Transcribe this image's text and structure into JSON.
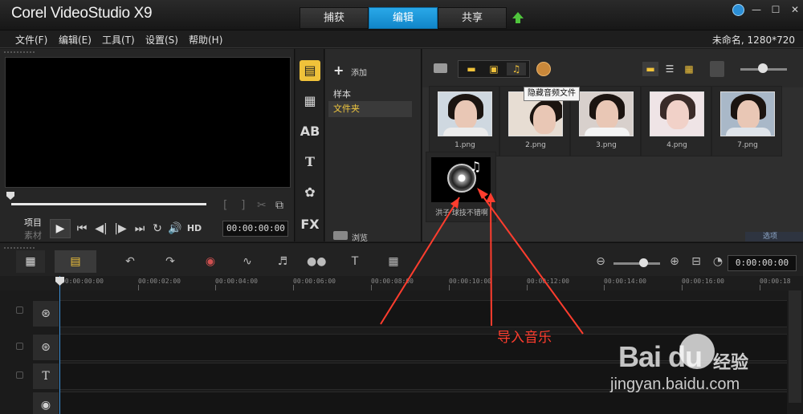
{
  "titlebar": {
    "app_title": "Corel VideoStudio X9",
    "tabs": [
      {
        "label": "捕获",
        "active": false
      },
      {
        "label": "编辑",
        "active": true
      },
      {
        "label": "共享",
        "active": false
      }
    ],
    "accent_color": "#1b9ad8"
  },
  "menu": {
    "items": [
      "文件(F)",
      "编辑(E)",
      "工具(T)",
      "设置(S)",
      "帮助(H)"
    ],
    "project_info": "未命名, 1280*720"
  },
  "player": {
    "mode_project": "项目",
    "mode_clip": "素材",
    "hd_label": "HD",
    "timecode": "00:00:00:00"
  },
  "library_nav": {
    "add_label": "添加",
    "items": [
      {
        "label": "样本",
        "selected": false
      },
      {
        "label": "文件夹",
        "selected": true
      }
    ],
    "browse_label": "浏览",
    "options_label": "选项"
  },
  "library": {
    "tooltip": "隐藏音频文件",
    "clips": [
      {
        "label": "1.png",
        "type": "image"
      },
      {
        "label": "2.png",
        "type": "image"
      },
      {
        "label": "3.png",
        "type": "image"
      },
      {
        "label": "4.png",
        "type": "image"
      },
      {
        "label": "7.png",
        "type": "image"
      },
      {
        "label": "洪子 球技不错啊",
        "type": "audio"
      }
    ]
  },
  "timeline": {
    "timecode": "0:00:00:00",
    "ruler_ticks": [
      "00:00:00:00",
      "00:00:02:00",
      "00:00:04:00",
      "00:00:06:00",
      "00:00:08:00",
      "00:00:10:00",
      "00:00:12:00",
      "00:00:14:00",
      "00:00:16:00",
      "00:00:18"
    ]
  },
  "annotation": {
    "label": "导入音乐",
    "color": "#ff3d2e"
  },
  "watermark": {
    "brand": "Bai du",
    "product": "经验",
    "url": "jingyan.baidu.com"
  }
}
